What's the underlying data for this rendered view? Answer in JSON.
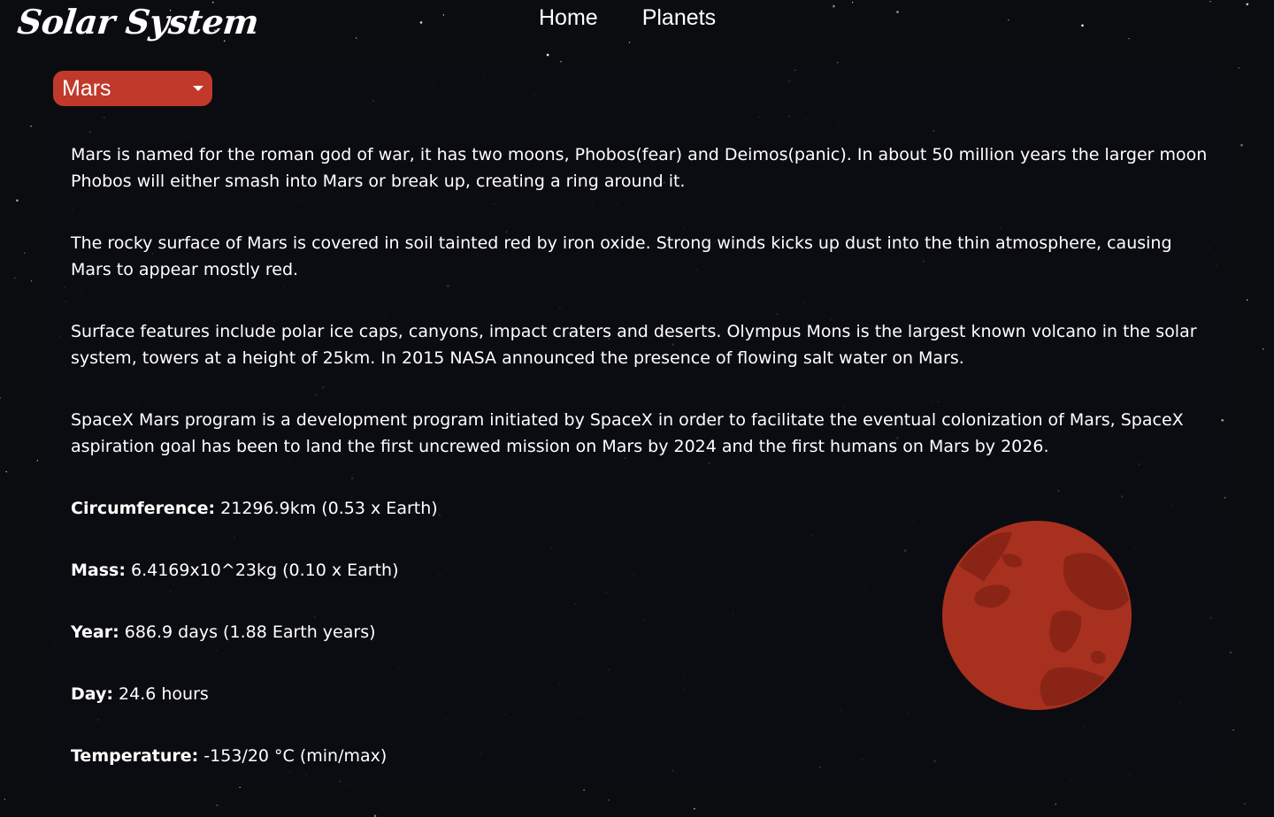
{
  "header": {
    "logo": "Solar System",
    "nav": [
      "Home",
      "Planets"
    ]
  },
  "planet_select": {
    "value": "Mars"
  },
  "description": [
    "Mars is named for the roman god of war, it has two moons, Phobos(fear) and Deimos(panic). In about 50 million years the larger moon Phobos will either smash into Mars or break up, creating a ring around it.",
    "The rocky surface of Mars is covered in soil tainted red by iron oxide. Strong winds kicks up dust into the thin atmosphere, causing Mars to appear mostly red.",
    "Surface features include polar ice caps, canyons, impact craters and deserts. Olympus Mons is the largest known volcano in the solar system, towers at a height of 25km. In 2015 NASA announced the presence of flowing salt water on Mars.",
    "SpaceX Mars program is a development program initiated by SpaceX in order to facilitate the eventual colonization of Mars, SpaceX aspiration goal has been to land the first uncrewed mission on Mars by 2024 and the first humans on Mars by 2026."
  ],
  "facts": [
    {
      "label": "Circumference:",
      "value": " 21296.9km (0.53 x Earth)"
    },
    {
      "label": "Mass:",
      "value": " 6.4169x10^23kg (0.10 x Earth)"
    },
    {
      "label": "Year:",
      "value": " 686.9 days (1.88 Earth years)"
    },
    {
      "label": "Day:",
      "value": " 24.6 hours"
    },
    {
      "label": "Temperature:",
      "value": " -153/20 °C (min/max)"
    }
  ],
  "colors": {
    "background": "#0b0c10",
    "accent": "#c0392b",
    "planet": "#a8301f",
    "planet_dark": "#8a2416"
  },
  "icons": {
    "dropdown": "caret-down-icon",
    "planet": "mars-planet-icon"
  }
}
